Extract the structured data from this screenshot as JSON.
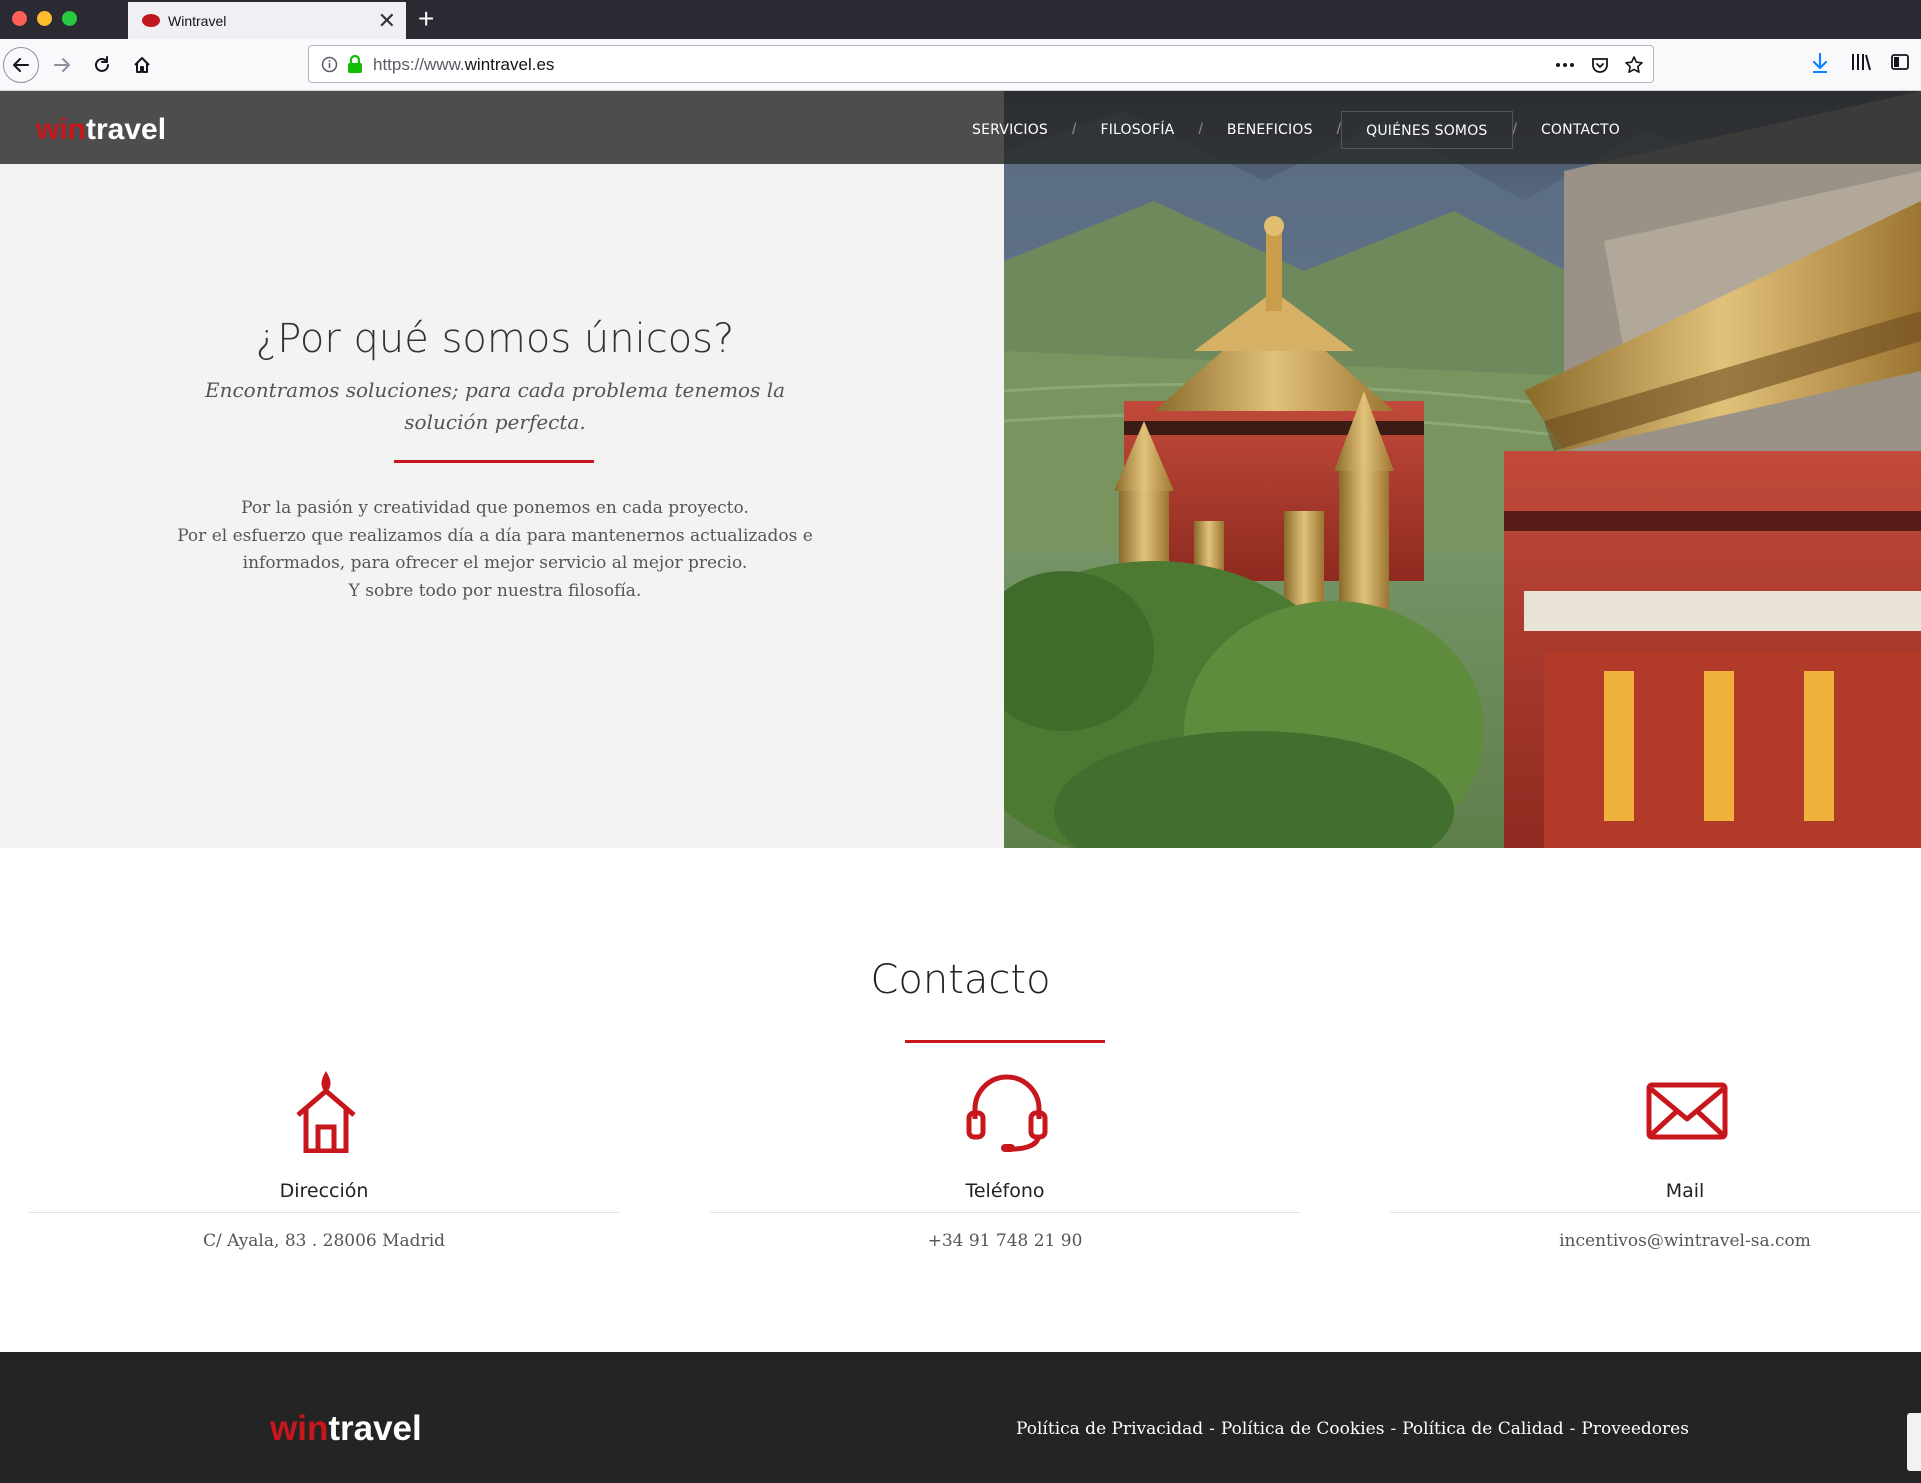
{
  "browser": {
    "tab_title": "Wintravel",
    "url_prefix": "https://www.",
    "url_domain": "wintravel.es",
    "colors": {
      "chrome_dark": "#2b2a33",
      "download_blue": "#0a84ff",
      "lock_green": "#12bc00"
    }
  },
  "header": {
    "logo_win": "win",
    "logo_travel": "travel",
    "menu": [
      {
        "label": "SERVICIOS"
      },
      {
        "label": "FILOSOFÍA"
      },
      {
        "label": "BENEFICIOS"
      },
      {
        "label": "QUIÉNES SOMOS"
      },
      {
        "label": "CONTACTO"
      }
    ]
  },
  "why": {
    "title": "¿Por qué somos únicos?",
    "subtitle": "Encontramos soluciones; para cada problema tenemos la solución perfecta.",
    "body": [
      "Por la pasión y creatividad que ponemos en cada proyecto.",
      "Por el esfuerzo que realizamos día a día para mantenernos actualizados e informados, para ofrecer el mejor servicio al mejor precio.",
      "Y sobre todo por nuestra filosofía."
    ]
  },
  "contact": {
    "title": "Contacto",
    "items": [
      {
        "icon": "house-icon",
        "label": "Dirección",
        "value": "C/ Ayala, 83 . 28006 Madrid"
      },
      {
        "icon": "headset-icon",
        "label": "Teléfono",
        "value": "+34 91 748 21 90"
      },
      {
        "icon": "envelope-icon",
        "label": "Mail",
        "value": "incentivos@wintravel-sa.com"
      }
    ]
  },
  "footer": {
    "logo_win": "win",
    "logo_travel": "travel",
    "links": [
      "Política de Privacidad",
      "Política de Cookies",
      "Política de Calidad",
      "Proveedores"
    ],
    "separator": "-"
  },
  "brand_color": "#c8161d"
}
